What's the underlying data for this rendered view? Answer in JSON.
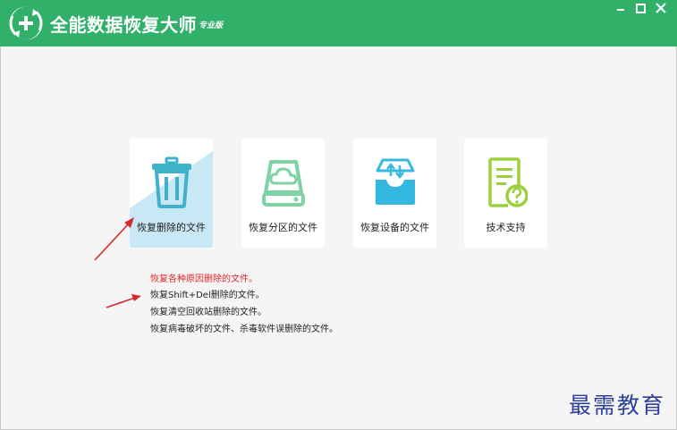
{
  "app": {
    "title": "全能数据恢复大师",
    "edition": "专业版"
  },
  "window_controls": {
    "minimize_icon": "minimize-icon",
    "maximize_icon": "maximize-icon",
    "close_icon": "close-icon"
  },
  "cards": [
    {
      "label": "恢复删除的文件",
      "icon": "trash-icon",
      "selected": true
    },
    {
      "label": "恢复分区的文件",
      "icon": "cloud-drive-icon",
      "selected": false
    },
    {
      "label": "恢复设备的文件",
      "icon": "device-transfer-icon",
      "selected": false
    },
    {
      "label": "技术支持",
      "icon": "document-question-icon",
      "selected": false
    }
  ],
  "description": [
    "恢复各种原因删除的文件。",
    "恢复Shift+Del删除的文件。",
    "恢复清空回收站删除的文件。",
    "恢复病毒破坏的文件、杀毒软件误删除的文件。"
  ],
  "watermark": "最需教育",
  "colors": {
    "titlebar": "#31b06a",
    "background": "#f5f5f5",
    "highlight": "#c9e8f5",
    "highlight_text": "#e0262b",
    "annotation_arrow": "#d42a2a",
    "watermark": "#2e3f9b"
  }
}
